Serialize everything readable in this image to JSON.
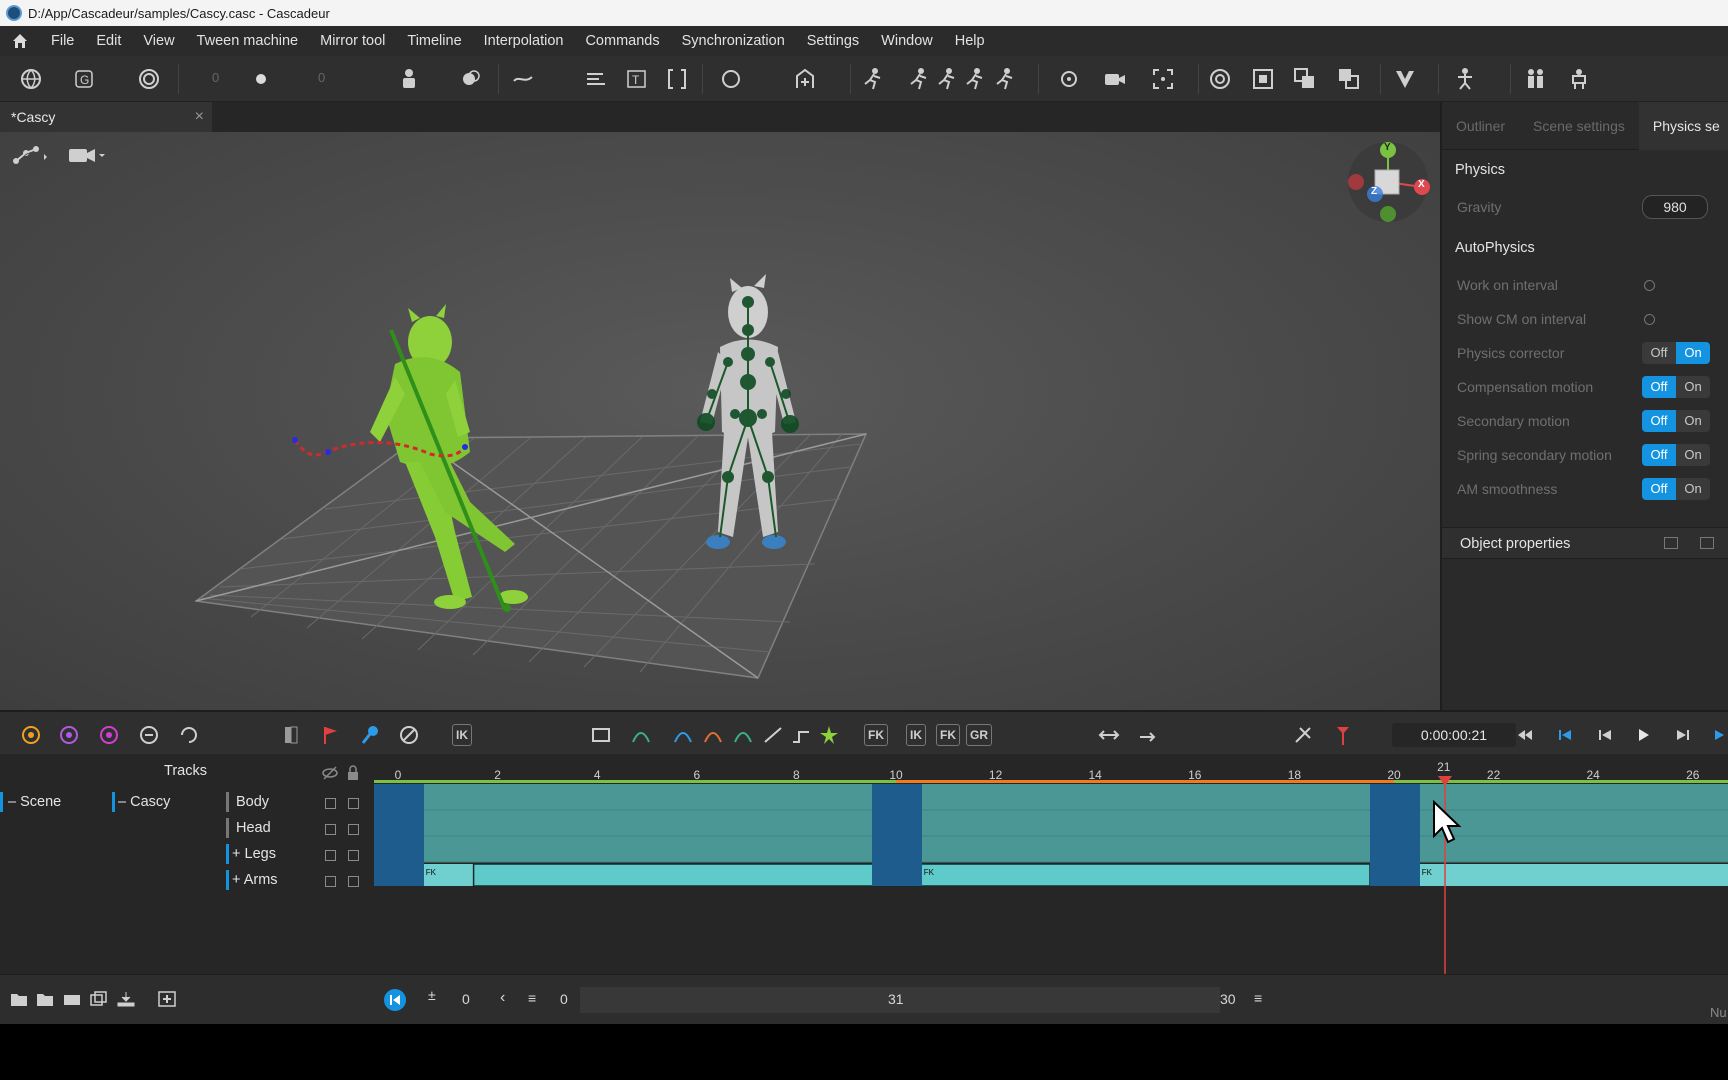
{
  "window": {
    "title": "D:/App/Cascadeur/samples/Cascy.casc - Cascadeur"
  },
  "menu": [
    "File",
    "Edit",
    "View",
    "Tween machine",
    "Mirror tool",
    "Timeline",
    "Interpolation",
    "Commands",
    "Synchronization",
    "Settings",
    "Window",
    "Help"
  ],
  "toolbar": {
    "field_a": "0",
    "field_b": "0"
  },
  "document_tab": {
    "label": "*Cascy",
    "close": "×"
  },
  "viewport": {
    "gizmo_axes": {
      "y": "Y",
      "x": "X",
      "z": "Z"
    }
  },
  "right_panel": {
    "tabs": [
      "Outliner",
      "Scene settings",
      "Physics se"
    ],
    "physics_header": "Physics",
    "gravity_label": "Gravity",
    "gravity_value": "980",
    "autophysics_header": "AutoPhysics",
    "rows": [
      {
        "label": "Work on interval",
        "type": "radio"
      },
      {
        "label": "Show CM on interval",
        "type": "radio"
      },
      {
        "label": "Physics corrector",
        "type": "toggle",
        "state": "On"
      },
      {
        "label": "Compensation motion",
        "type": "toggle",
        "state": "Off"
      },
      {
        "label": "Secondary motion",
        "type": "toggle",
        "state": "Off"
      },
      {
        "label": "Spring secondary motion",
        "type": "toggle",
        "state": "Off"
      },
      {
        "label": "AM smoothness",
        "type": "toggle",
        "state": "Off"
      }
    ],
    "off_label": "Off",
    "on_label": "On",
    "object_properties": "Object properties"
  },
  "timeline_toolbar": {
    "ik_label": "IK",
    "fk_label": "FK",
    "ik2_label": "IK",
    "fk2_label": "FK",
    "gr_label": "GR",
    "timecode": "0:00:00:21"
  },
  "tracks": {
    "header": "Tracks",
    "scene": "Scene",
    "object": "Cascy",
    "items": [
      "Body",
      "Head",
      "Legs",
      "Arms"
    ],
    "ruler_ticks": [
      "0",
      "2",
      "4",
      "6",
      "8",
      "10",
      "12",
      "14",
      "16",
      "18",
      "20",
      "21",
      "22",
      "24",
      "26"
    ],
    "current_frame": 21,
    "fk_marker": "FK"
  },
  "bottom_bar": {
    "start_value": "0",
    "range_start": "0",
    "range_mid": "31",
    "range_end": "30",
    "corner": "Nu"
  },
  "colors": {
    "accent_blue": "#1493e0",
    "track_teal": "#4b9796",
    "key_dark_blue": "#1e5c8e",
    "interval_orange": "#f07a1e",
    "interval_green": "#7bc143",
    "character_green": "#8ed13a"
  }
}
